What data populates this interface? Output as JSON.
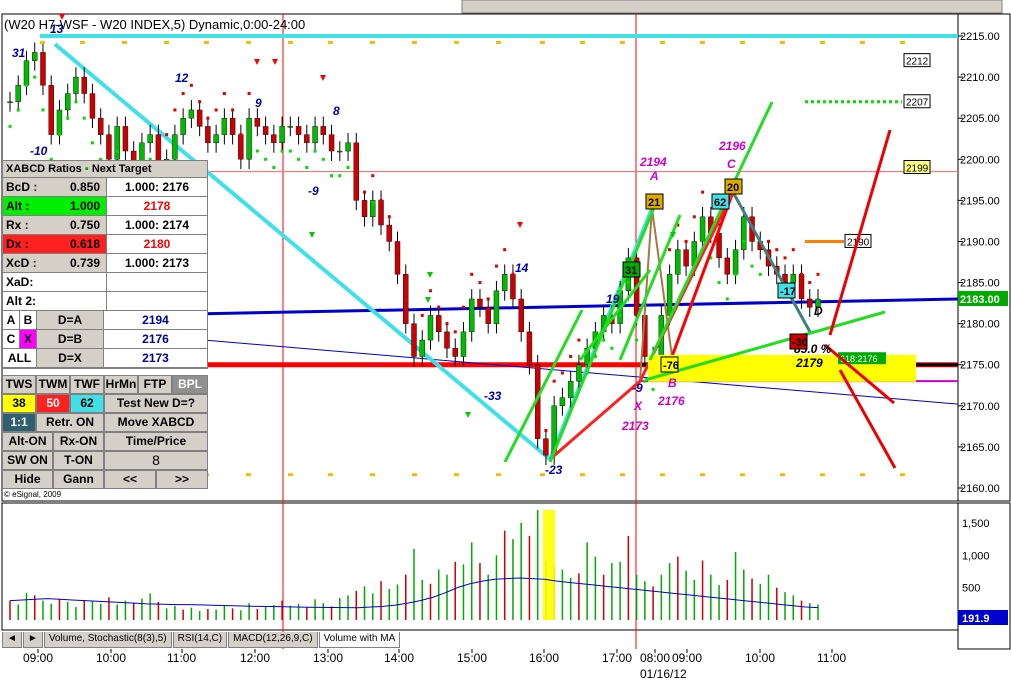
{
  "window": {
    "title": "(W20 H7-WSF - W20 INDEX,5) Dynamic,0:00-24:00",
    "copyright": "© eSignal, 2009",
    "date_label": "01/16/12"
  },
  "price_axis": {
    "ticks": [
      "2215.00",
      "2210.00",
      "2205.00",
      "2200.00",
      "2195.00",
      "2190.00",
      "2185.00",
      "2180.00",
      "2175.00",
      "2170.00",
      "2165.00",
      "2160.00"
    ],
    "current_price": "2183.00",
    "tags": [
      "2212",
      "2207",
      "2199",
      "2190"
    ],
    "target_box": "618:2176"
  },
  "volume_axis": {
    "ticks": [
      "1,500",
      "1,000",
      "500"
    ],
    "current": "191.9"
  },
  "time_axis": {
    "ticks": [
      "09:00",
      "10:00",
      "11:00",
      "12:00",
      "13:00",
      "14:00",
      "15:00",
      "16:00",
      "17:00",
      "08:00",
      "09:00",
      "10:00",
      "11:00"
    ]
  },
  "labels": {
    "swing": [
      "31",
      "13",
      "-10",
      "12",
      "9",
      "8",
      "-9",
      "14",
      "-33",
      "-23",
      "19",
      "-9"
    ],
    "pattern": {
      "A": "A",
      "B": "B",
      "C": "C",
      "D": "D",
      "X": "X",
      "a_val": "2194",
      "b_val": "2176",
      "c_val": "2196",
      "x_val": "2173",
      "pct": "85.0 %",
      "d_val": "2179"
    },
    "boxes": [
      "21",
      "31",
      "62",
      "20",
      "-76",
      "-17",
      "-30"
    ]
  },
  "panel": {
    "title": "XABCD Ratios",
    "title2": "Next Target",
    "rows": [
      {
        "k": "BcD :",
        "v1": "0.850",
        "v2": "1.000: 2176"
      },
      {
        "k": "Alt  :",
        "v1": "1.000",
        "v2": "2178"
      },
      {
        "k": "Rx  :",
        "v1": "0.750",
        "v2": "1.000: 2174"
      },
      {
        "k": "Dx  :",
        "v1": "0.618",
        "v2": "2180"
      },
      {
        "k": "XcD :",
        "v1": "0.739",
        "v2": "1.000: 2173"
      },
      {
        "k": "XaD:",
        "v1": "",
        "v2": ""
      },
      {
        "k": "Alt 2:",
        "v1": "",
        "v2": ""
      }
    ],
    "dset": [
      {
        "a": "A",
        "b": "B",
        "c": "D=A",
        "v": "2194"
      },
      {
        "a": "C",
        "b": "X",
        "c": "D=B",
        "v": "2176"
      },
      {
        "a": "ALL",
        "b": "",
        "c": "D=X",
        "v": "2173"
      }
    ],
    "buttons": {
      "tws": "TWS",
      "twm": "TWM",
      "twf": "TWF",
      "hrmn": "HrMn",
      "ftp": "FTP",
      "bpl": "BPL",
      "n38": "38",
      "n50": "50",
      "n62": "62",
      "test": "Test New D=?",
      "ratio": "1:1",
      "retr": "Retr. ON",
      "move": "Move XABCD",
      "alt": "Alt-ON",
      "rx": "Rx-ON",
      "timeprice": "Time/Price",
      "sw": "SW ON",
      "t": "T-ON",
      "num": "8",
      "hide": "Hide",
      "gann": "Gann",
      "prev": "<<",
      "next": ">>"
    }
  },
  "tabs": [
    "Volume, Stochastic(8(3),5)",
    "RSI(14,C)",
    "MACD(12,26,9,C)",
    "Volume with MA"
  ],
  "colors": {
    "cyan": "#40e0e8",
    "blue": "#0000cc",
    "red": "#ff0000",
    "green": "#00cc00",
    "magenta": "#cc00cc",
    "yellow": "#ffff00"
  },
  "chart_data": {
    "type": "candlestick",
    "title": "(W20 H7-WSF - W20 INDEX,5) Dynamic,0:00-24:00",
    "ylim": [
      2158,
      2217
    ],
    "volume_ylim": [
      0,
      1700
    ],
    "session_breaks": [
      "12:20",
      "17:05"
    ],
    "closes": [
      2207,
      2209,
      2212,
      2213,
      2209,
      2203,
      2206,
      2208,
      2210,
      2208,
      2205,
      2203,
      2200,
      2204,
      2201,
      2199,
      2202,
      2203,
      2199,
      2200,
      2203,
      2205,
      2206,
      2204,
      2202,
      2203,
      2205,
      2203,
      2200,
      2205,
      2204,
      2203,
      2202,
      2204,
      2204,
      2203,
      2202,
      2204,
      2203,
      2201,
      2201,
      2202,
      2195,
      2193,
      2195,
      2192,
      2190,
      2186,
      2180,
      2176,
      2178,
      2181,
      2179,
      2177,
      2176,
      2179,
      2183,
      2182,
      2180,
      2184,
      2186,
      2183,
      2179,
      2175,
      2166,
      2164,
      2170,
      2171,
      2173,
      2175,
      2177,
      2179,
      2181,
      2180,
      2184,
      2188,
      2181,
      2176,
      2175,
      2181,
      2186,
      2189,
      2187,
      2190,
      2193,
      2191,
      2188,
      2186,
      2189,
      2193,
      2190,
      2189,
      2187,
      2186,
      2185,
      2186,
      2183,
      2182,
      2183
    ],
    "volumes": [
      300,
      240,
      420,
      380,
      300,
      250,
      320,
      280,
      200,
      310,
      290,
      250,
      350,
      240,
      300,
      260,
      330,
      410,
      280,
      180,
      220,
      160,
      190,
      140,
      170,
      160,
      220,
      180,
      150,
      260,
      170,
      210,
      230,
      300,
      220,
      250,
      190,
      320,
      260,
      210,
      340,
      380,
      450,
      520,
      410,
      600,
      480,
      550,
      700,
      1100,
      620,
      560,
      780,
      700,
      900,
      860,
      1200,
      880,
      700,
      1000,
      1380,
      1250,
      1500,
      1300,
      1700,
      900,
      820,
      780,
      650,
      720,
      1200,
      980,
      700,
      880,
      900,
      1300,
      700,
      600,
      520,
      700,
      880,
      980,
      760,
      620,
      920,
      700,
      540,
      620,
      1050,
      780,
      640,
      560,
      700,
      500,
      430,
      380,
      300,
      260,
      240
    ],
    "volume_ma": [
      300,
      310,
      320,
      330,
      320,
      310,
      300,
      290,
      280,
      270,
      260,
      250,
      245,
      240,
      238,
      235,
      230,
      225,
      220,
      215,
      210,
      208,
      205,
      200,
      198,
      196,
      194,
      192,
      190,
      200,
      210,
      230,
      260,
      300,
      350,
      420,
      500,
      560,
      600,
      630,
      640,
      650,
      640,
      630,
      600,
      580,
      560,
      540,
      520,
      500,
      480,
      460,
      440,
      420,
      400,
      380,
      360,
      340,
      320,
      300,
      280,
      260,
      240,
      220,
      200,
      192
    ],
    "fib_levels": [
      {
        "name": "2212",
        "value": 2212
      },
      {
        "name": "2207",
        "value": 2207
      },
      {
        "name": "2199",
        "value": 2199
      },
      {
        "name": "2190",
        "value": 2190
      }
    ],
    "pattern": {
      "X": 2173,
      "A": 2194,
      "B": 2176,
      "C": 2196,
      "D": 2179
    }
  }
}
